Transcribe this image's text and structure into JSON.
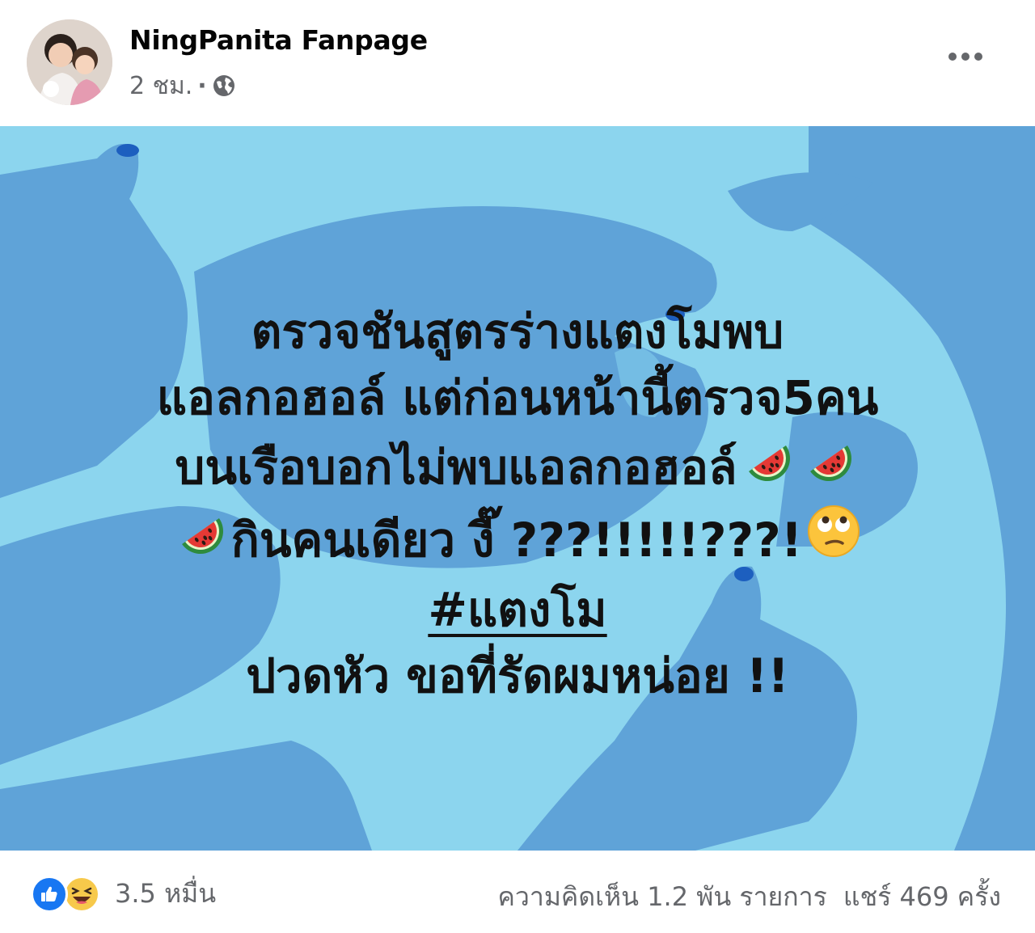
{
  "header": {
    "page_name": "NingPanita Fanpage",
    "time": "2 ชม.",
    "separator": "·",
    "privacy_icon": "globe-icon",
    "more_icon": "more-horizontal-icon"
  },
  "status": {
    "background_color": "#8cd5ee",
    "shape_color": "#5fa3d8",
    "lines": {
      "l1": "ตรวจชันสูตรร่างแตงโมพบ",
      "l2": "แอลกอฮอล์ แต่ก่อนหน้านี้ตรวจ5คน",
      "l3": "บนเรือบอกไม่พบแอลกอฮอล์",
      "l4": "กินคนเดียว งี๊ ???!!!!!???!",
      "hashtag": "#แตงโม",
      "l6": "ปวดหัว ขอที่รัดผมหน่อย !!"
    },
    "emojis": [
      "watermelon-emoji",
      "rolling-eyes-emoji"
    ]
  },
  "footer": {
    "reaction_icons": [
      "like-icon",
      "haha-icon"
    ],
    "reaction_count": "3.5 หมื่น",
    "comments": "ความคิดเห็น 1.2 พัน รายการ",
    "shares": "แชร์ 469 ครั้ง"
  },
  "colors": {
    "like_blue": "#1877f2",
    "haha_yellow": "#f7c94b",
    "muted_text": "#65676b"
  }
}
